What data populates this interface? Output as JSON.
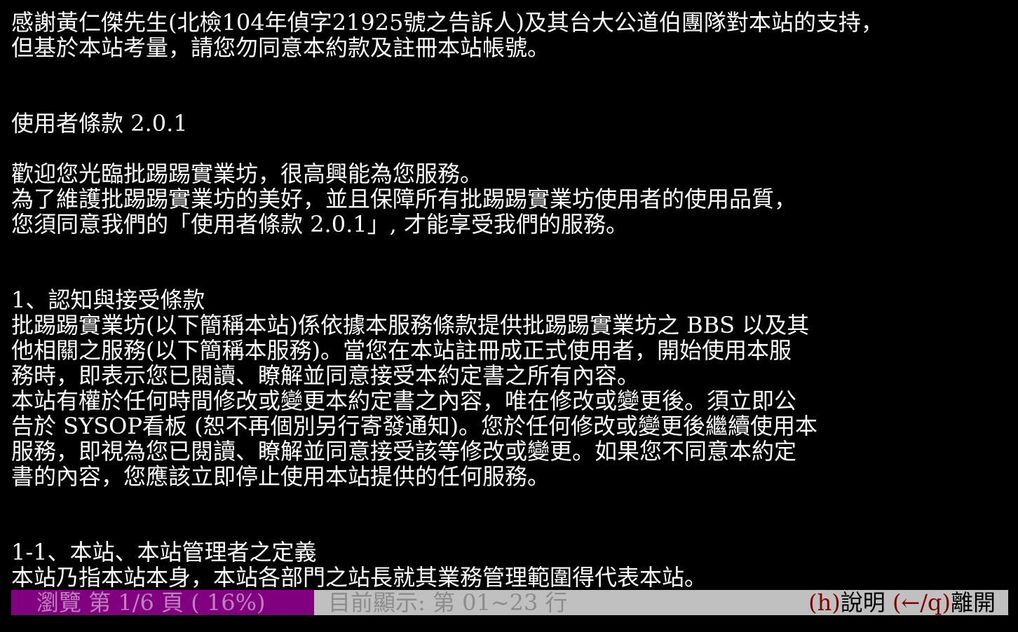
{
  "terminal": {
    "lines": [
      "感謝黃仁傑先生(北檢104年偵字21925號之告訴人)及其台大公道伯團隊對本站的支持，",
      "但基於本站考量，請您勿同意本約款及註冊本站帳號。",
      "",
      "",
      "使用者條款 2.0.1",
      "",
      "歡迎您光臨批踢踢實業坊，很高興能為您服務。",
      "為了維護批踢踢實業坊的美好，並且保障所有批踢踢實業坊使用者的使用品質，",
      "您須同意我們的「使用者條款 2.0.1」, 才能享受我們的服務。",
      "",
      "",
      "1、認知與接受條款",
      "批踢踢實業坊(以下簡稱本站)係依據本服務條款提供批踢踢實業坊之 BBS 以及其",
      "他相關之服務(以下簡稱本服務)。當您在本站註冊成正式使用者，開始使用本服",
      "務時，即表示您已閱讀、瞭解並同意接受本約定書之所有內容。",
      "本站有權於任何時間修改或變更本約定書之內容，唯在修改或變更後。須立即公",
      "告於 SYSOP看板 (恕不再個別另行寄發通知)。您於任何修改或變更後繼續使用本",
      "服務，即視為您已閱讀、瞭解並同意接受該等修改或變更。如果您不同意本約定",
      "書的內容，您應該立即停止使用本站提供的任何服務。",
      "",
      "",
      "1-1、本站、本站管理者之定義",
      "本站乃指本站本身，本站各部門之站長就其業務管理範圍得代表本站。"
    ]
  },
  "status": {
    "page_indicator": "瀏覽 第 1/6 頁 ( 16%)",
    "line_range": "目前顯示: 第 01~23 行",
    "help_key": "(h)",
    "help_label": "說明",
    "quit_key": "(←/q)",
    "quit_label": "離開"
  },
  "colors": {
    "background": "#000000",
    "text": "#ffffff",
    "page_indicator_bg": "#800080",
    "status_bg": "#c0c0c0",
    "key_color": "#800000"
  }
}
